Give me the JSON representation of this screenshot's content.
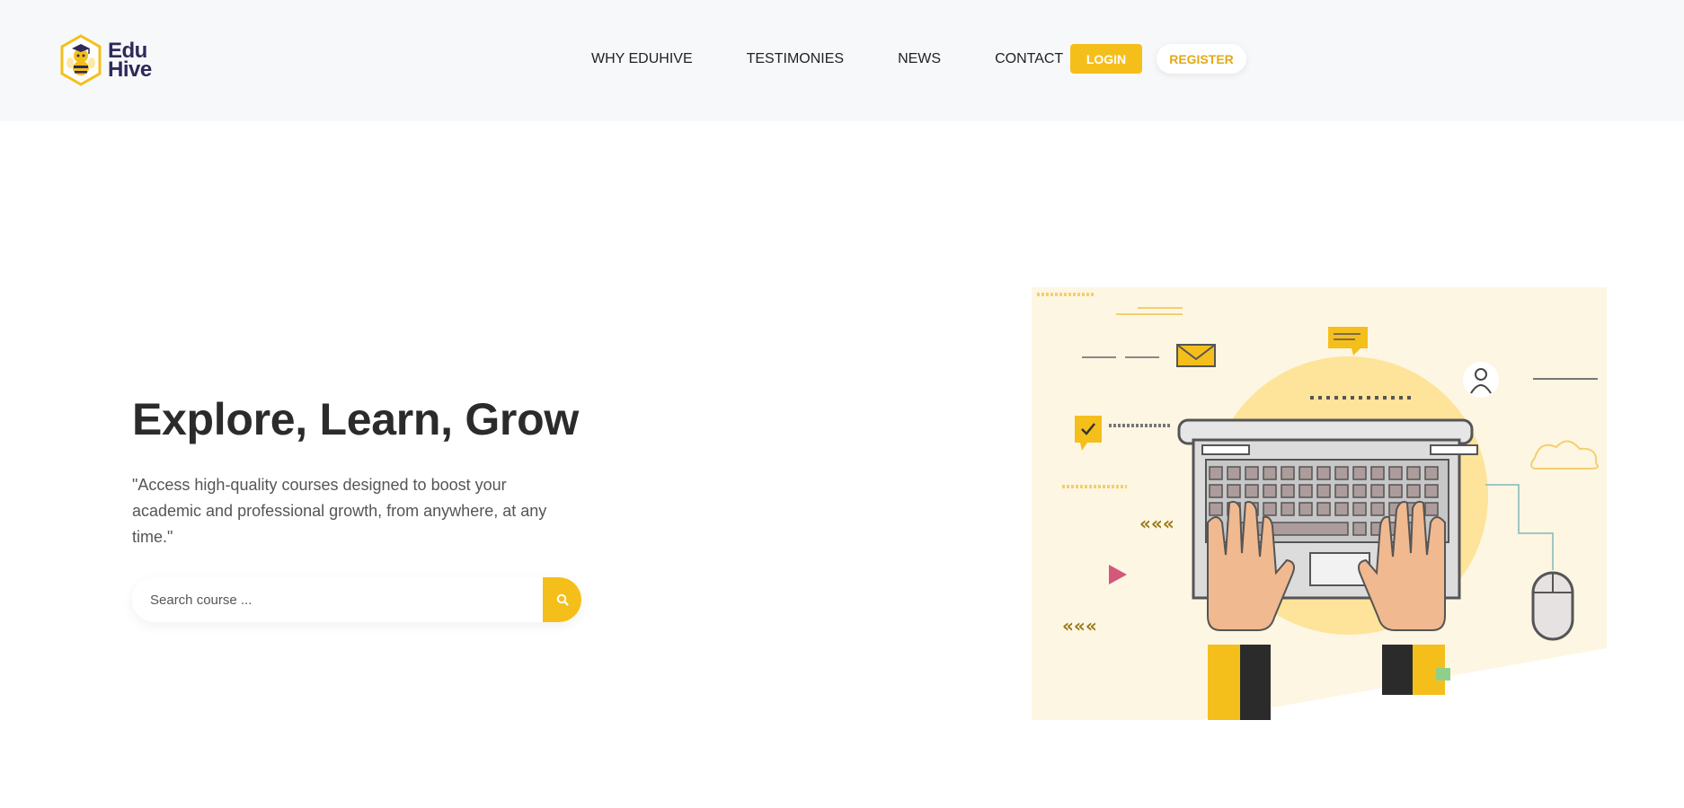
{
  "brand": {
    "line1": "Edu",
    "line2": "Hive",
    "colors": {
      "accent": "#f5bf1b",
      "dark": "#2d2a5a"
    }
  },
  "nav": {
    "items": [
      "WHY EDUHIVE",
      "TESTIMONIES",
      "NEWS",
      "CONTACT"
    ],
    "login": "LOGIN",
    "register": "REGISTER"
  },
  "hero": {
    "title": "Explore, Learn, Grow",
    "description": "\"Access high-quality courses designed to boost your academic and professional growth, from anywhere, at any time.\"",
    "search_placeholder": "Search course ..."
  },
  "icons": {
    "search": "search-icon",
    "logo": "bee-logo-icon"
  }
}
